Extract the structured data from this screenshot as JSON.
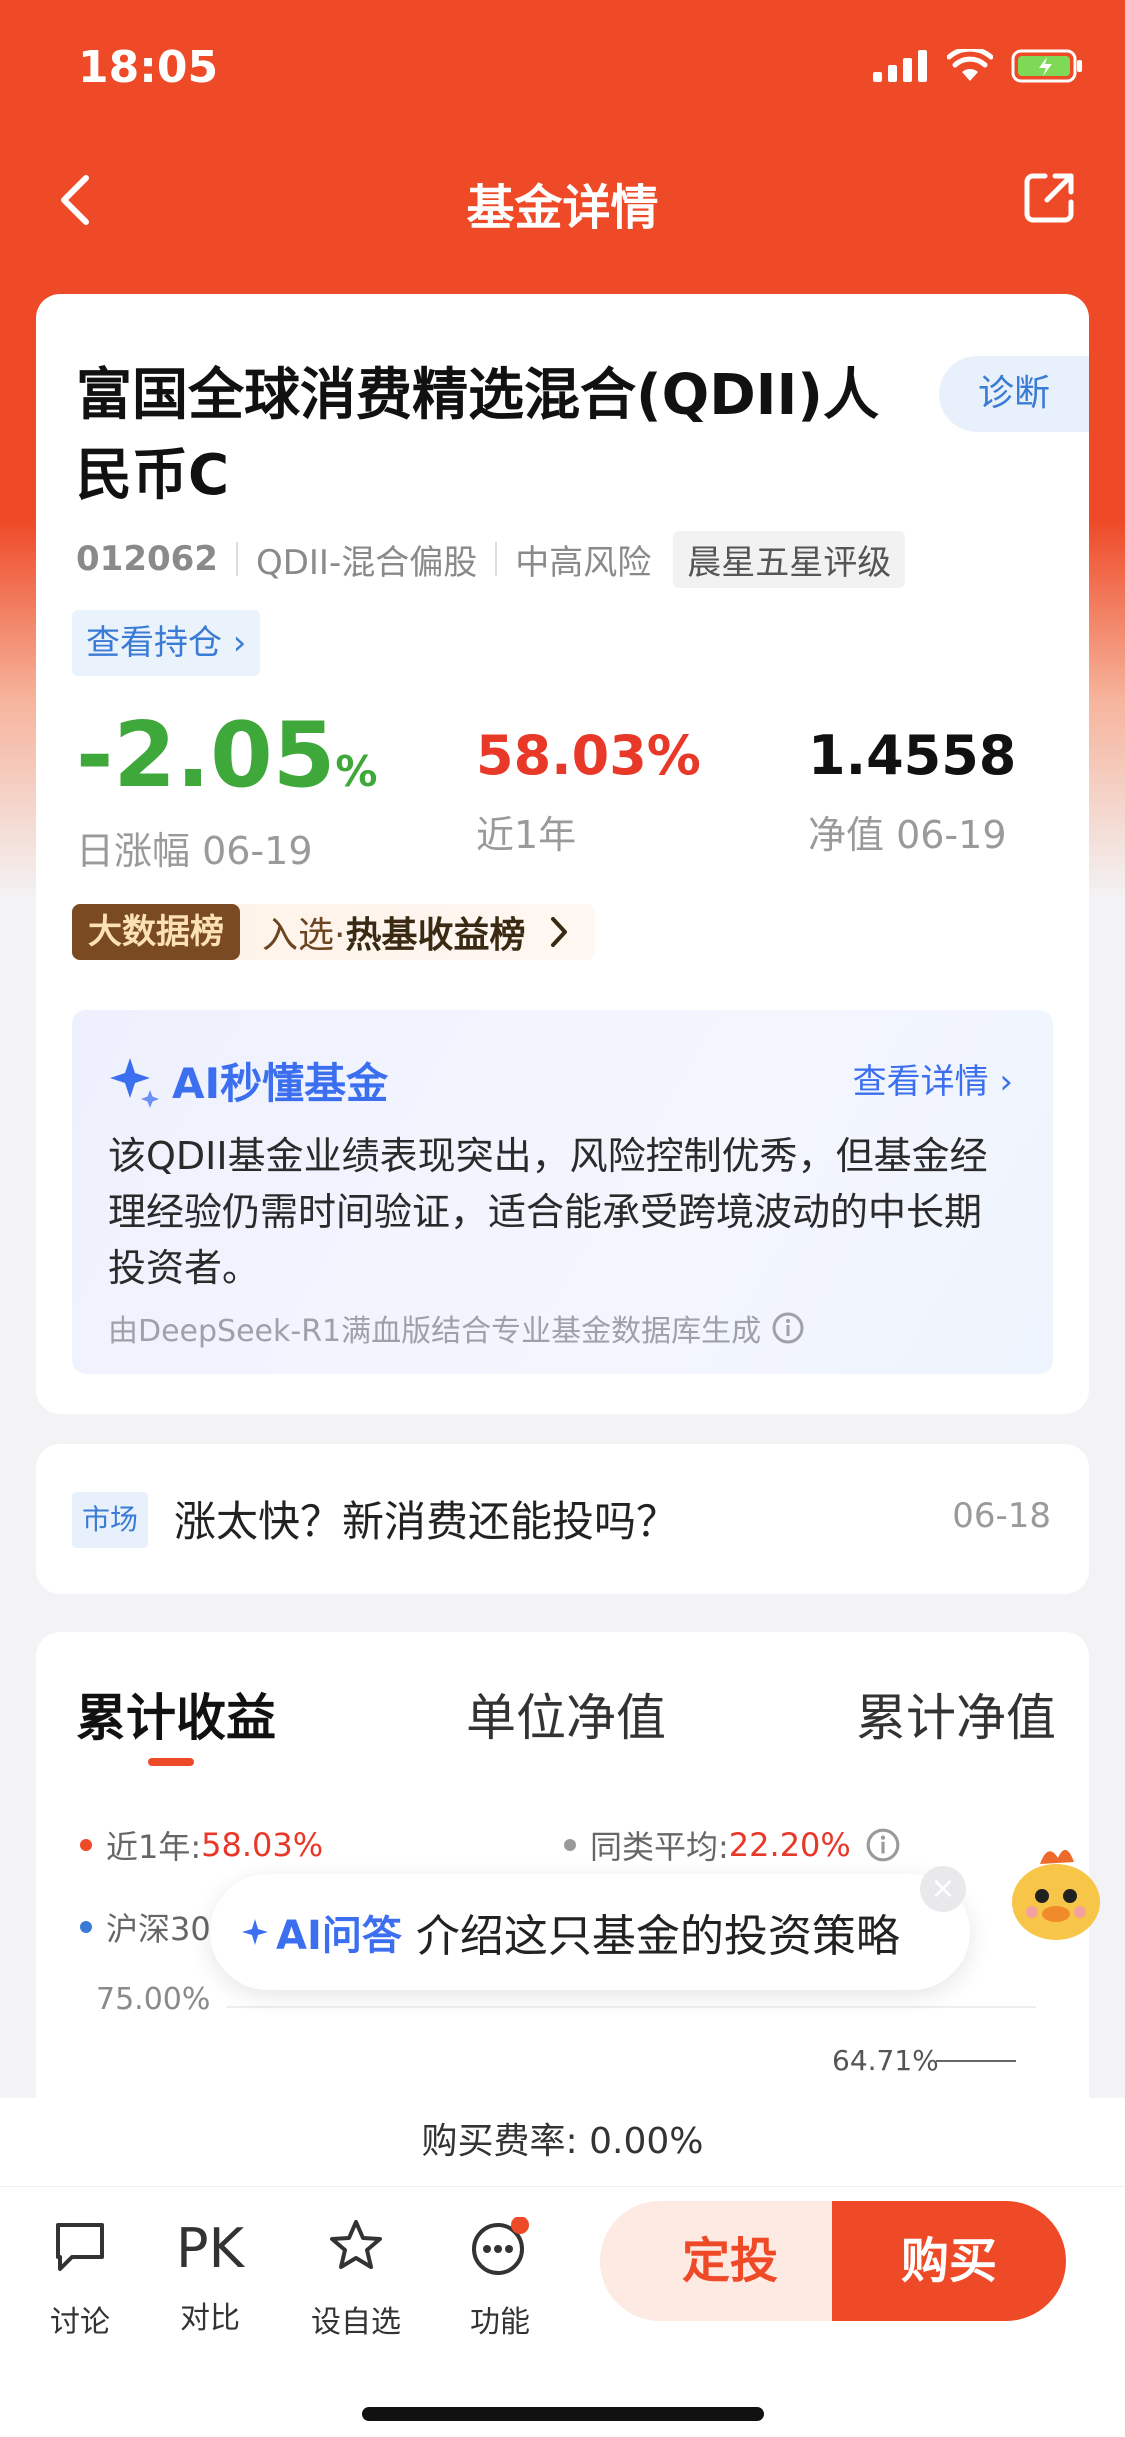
{
  "status": {
    "time": "18:05"
  },
  "nav": {
    "title": "基金详情"
  },
  "fund": {
    "name": "富国全球消费精选混合(QDII)人民币C",
    "diagnose_label": "诊断",
    "code": "012062",
    "category": "QDII-混合偏股",
    "risk": "中高风险",
    "rating": "晨星五星评级",
    "holdings_link": "查看持仓 ›",
    "daily_change": "-2.05",
    "daily_change_unit": "%",
    "daily_change_label": "日涨幅 06-19",
    "year_return": "58.03%",
    "year_return_label": "近1年",
    "nav_value": "1.4558",
    "nav_label": "净值 06-19"
  },
  "rank_banner": {
    "badge": "大数据榜",
    "text_prefix": "入选·",
    "text_main": "热基收益榜"
  },
  "ai_summary": {
    "title": "AI秒懂基金",
    "more": "查看详情 ›",
    "body": "该QDII基金业绩表现突出，风险控制优秀，但基金经理经验仍需时间验证，适合能承受跨境波动的中长期投资者。",
    "source": "由DeepSeek-R1满血版结合专业基金数据库生成"
  },
  "news": {
    "tag": "市场",
    "title": "涨太快？新消费还能投吗？",
    "date": "06-18"
  },
  "chart_section": {
    "tabs": [
      "累计收益",
      "单位净值",
      "累计净值"
    ],
    "legend": [
      {
        "label": "近1年:",
        "value": "58.03%",
        "color": "#ee4a27"
      },
      {
        "label": "同类平均:",
        "value": "22.20%",
        "color": "#9a9a9a"
      },
      {
        "label": "沪深30",
        "value": "",
        "color": "#3a7bd5"
      }
    ],
    "y_top": "75.00%",
    "value_label": "64.71%"
  },
  "ai_float": {
    "lead": "AI问答",
    "question": "介绍这只基金的投资策略",
    "close": "×"
  },
  "fee": {
    "text": "购买费率: 0.00%"
  },
  "tabbar": {
    "discuss": "讨论",
    "compare_icon": "PK",
    "compare": "对比",
    "watch": "设自选",
    "func": "功能",
    "auto_invest": "定投",
    "buy": "购买"
  }
}
